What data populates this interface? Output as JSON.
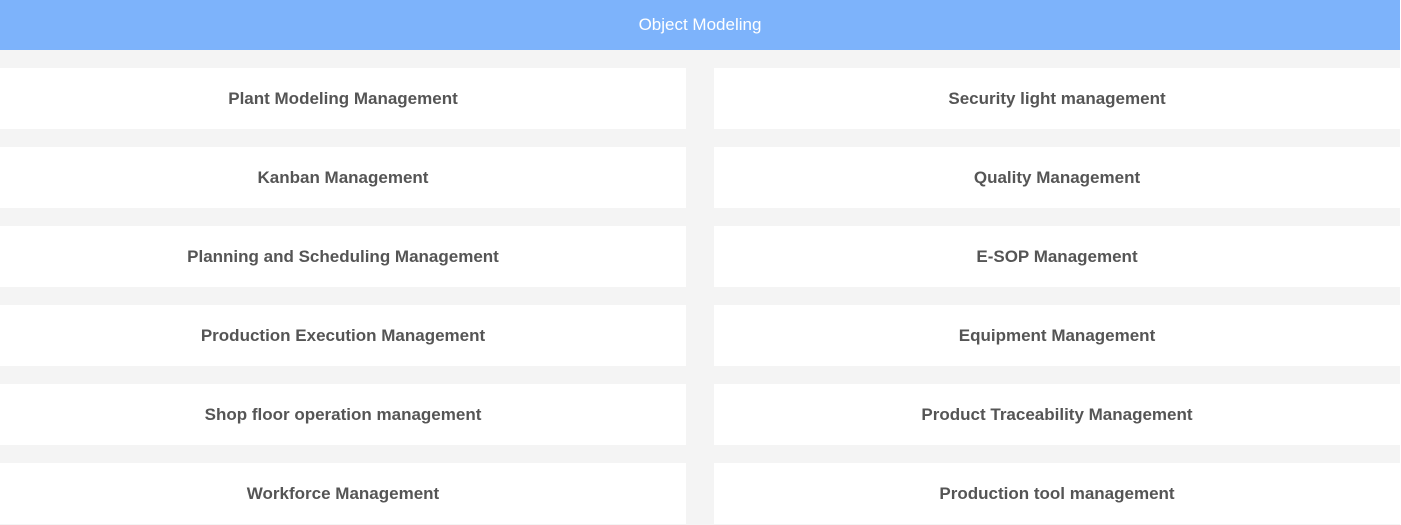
{
  "header": {
    "title": "Object Modeling"
  },
  "modules": [
    {
      "label": "Plant Modeling Management"
    },
    {
      "label": "Security light management"
    },
    {
      "label": "Kanban Management"
    },
    {
      "label": "Quality Management"
    },
    {
      "label": "Planning and Scheduling Management"
    },
    {
      "label": "E-SOP Management"
    },
    {
      "label": "Production Execution Management"
    },
    {
      "label": "Equipment Management"
    },
    {
      "label": "Shop floor operation management"
    },
    {
      "label": "Product Traceability Management"
    },
    {
      "label": "Workforce Management"
    },
    {
      "label": "Production tool management"
    }
  ],
  "colors": {
    "header_bg": "#7db3fb",
    "page_bg": "#f4f4f4",
    "card_bg": "#ffffff",
    "card_text": "#555555"
  }
}
